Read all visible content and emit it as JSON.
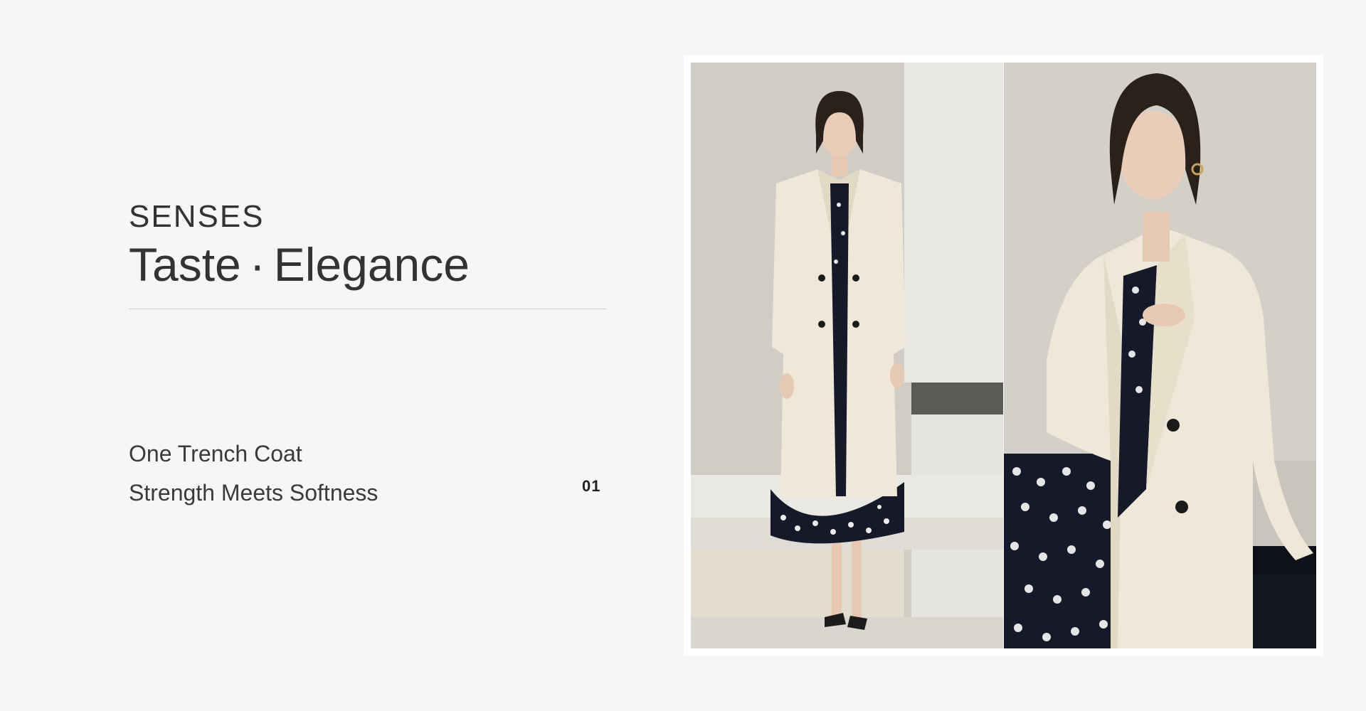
{
  "brand": {
    "label": "SENSES"
  },
  "headline": {
    "left": "Taste",
    "separator": "·",
    "right": "Elegance"
  },
  "tagline": {
    "line1": "One Trench Coat",
    "line2": "Strength Meets Softness"
  },
  "slide": {
    "index": "01"
  },
  "photos": [
    {
      "subject": "full-length-model-trench-coat-photo"
    },
    {
      "subject": "closeup-model-trench-coat-photo"
    }
  ],
  "colors": {
    "background": "#f6f6f6",
    "text": "#333333",
    "coat": "#efe8d8",
    "dress": "#15192a"
  }
}
